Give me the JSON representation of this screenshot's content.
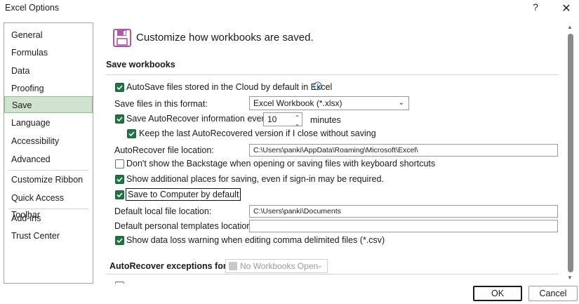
{
  "window": {
    "title": "Excel Options",
    "help": "?",
    "close": "✕"
  },
  "sidebar": {
    "items": [
      {
        "label": "General"
      },
      {
        "label": "Formulas"
      },
      {
        "label": "Data"
      },
      {
        "label": "Proofing"
      },
      {
        "label": "Save",
        "selected": true
      },
      {
        "label": "Language"
      },
      {
        "label": "Accessibility"
      },
      {
        "label": "Advanced"
      },
      {
        "label": "Customize Ribbon"
      },
      {
        "label": "Quick Access Toolbar"
      },
      {
        "label": "Add-ins"
      },
      {
        "label": "Trust Center"
      }
    ]
  },
  "main": {
    "header": "Customize how workbooks are saved.",
    "save_workbooks": {
      "title": "Save workbooks",
      "autosave_label": "AutoSave files stored in the Cloud by default in Excel",
      "autosave_checked": true,
      "format_label": "Save files in this format:",
      "format_value": "Excel Workbook (*.xlsx)",
      "autorecover_label": "Save AutoRecover information every",
      "autorecover_checked": true,
      "autorecover_minutes": "10",
      "minutes_label": "minutes",
      "keep_last_label": "Keep the last AutoRecovered version if I close without saving",
      "keep_last_checked": true,
      "ar_location_label": "AutoRecover file location:",
      "ar_location_value": "C:\\Users\\panki\\AppData\\Roaming\\Microsoft\\Excel\\",
      "backstage_label": "Don't show the Backstage when opening or saving files with keyboard shortcuts",
      "backstage_checked": false,
      "additional_places_label": "Show additional places for saving, even if sign-in may be required.",
      "additional_places_checked": true,
      "save_computer_label": "Save to Computer by default",
      "save_computer_checked": true,
      "local_location_label": "Default local file location:",
      "local_location_value": "C:\\Users\\panki\\Documents",
      "templates_location_label": "Default personal templates location:",
      "templates_location_value": "",
      "data_loss_label": "Show data loss warning when editing comma delimited files (*.csv)",
      "data_loss_checked": true
    },
    "autorecover_exceptions": {
      "title": "AutoRecover exceptions for:",
      "workbook_value": "No Workbooks Open"
    }
  },
  "footer": {
    "ok": "OK",
    "cancel": "Cancel"
  },
  "colors": {
    "accent": "#217346",
    "selected_nav": "#cfe3cf",
    "save_icon": "#b455a8"
  }
}
